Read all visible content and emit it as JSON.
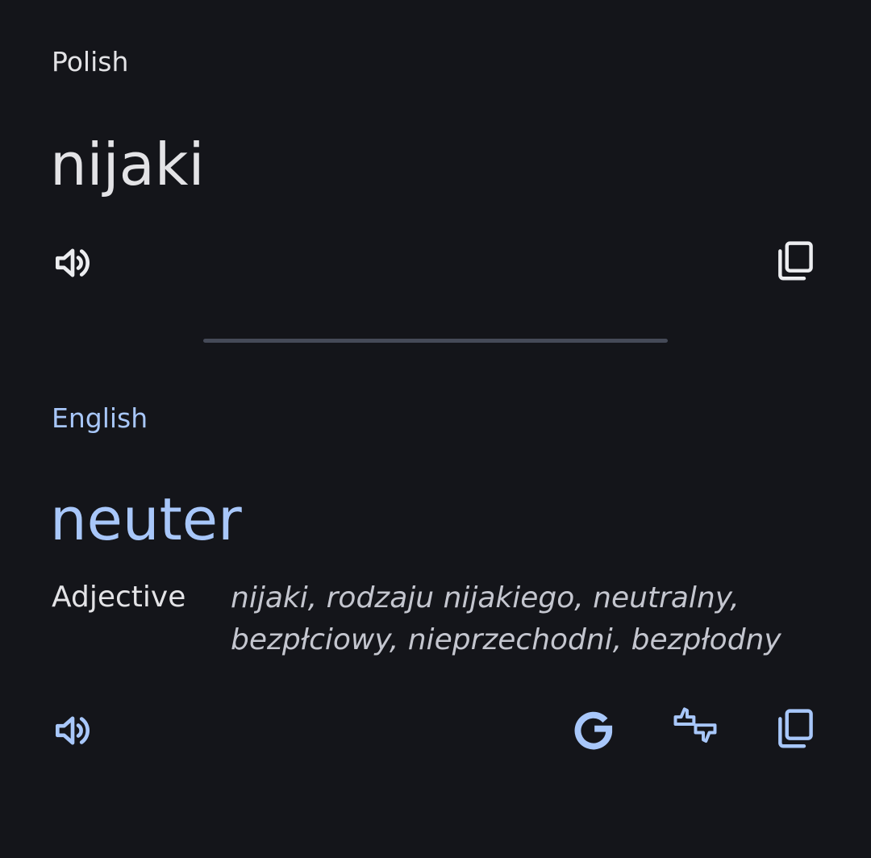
{
  "source": {
    "language": "Polish",
    "text": "nijaki",
    "speak_icon": "volume-up-icon",
    "copy_icon": "copy-icon"
  },
  "target": {
    "language": "English",
    "text": "neuter",
    "part_of_speech": "Adjective",
    "alternatives_line1": "nijaki, rodzaju nijakiego, neutralny,",
    "alternatives_line2": "bezpłciowy, nieprzechodni, bezpłodny",
    "speak_icon": "volume-up-icon",
    "google_icon": "google-g-icon",
    "rate_icon": "thumbs-up-down-icon",
    "copy_icon": "copy-icon"
  },
  "colors": {
    "background": "#14151a",
    "source_text": "#e3e3e6",
    "accent": "#a8c7fa",
    "alternatives": "#c4c6cf",
    "divider": "#454a58"
  }
}
